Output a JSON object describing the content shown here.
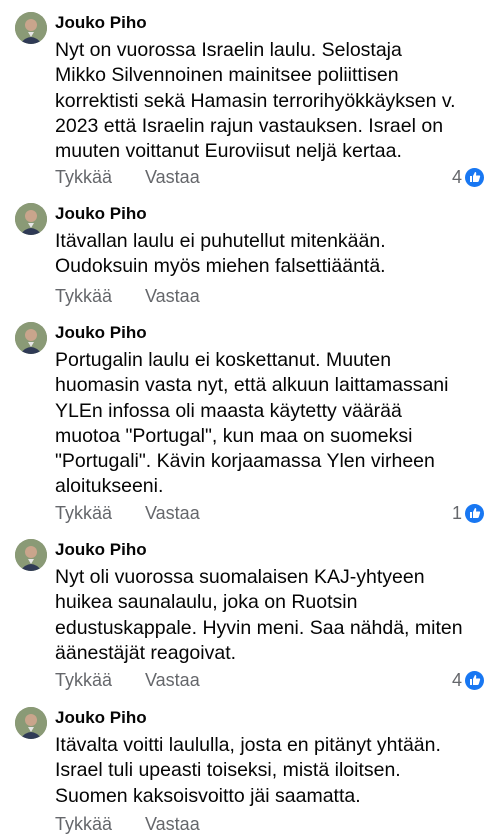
{
  "comments": [
    {
      "author": "Jouko Piho",
      "text": "Nyt on vuorossa Israelin laulu. Selostaja\nMikko Silvennoinen mainitsee poliittisen\nkorrektisti sekä Hamasin terrorihyökkäyksen v.\n2023 että Israelin rajun vastauksen. Israel on\nmuuten voittanut Euroviisut neljä kertaa.",
      "like_label": "Tykkää",
      "reply_label": "Vastaa",
      "reaction_count": "4",
      "reaction_icon": "thumbs-up-icon"
    },
    {
      "author": "Jouko Piho",
      "text": "Itävallan laulu ei puhutellut mitenkään.\nOudoksuin myös miehen falsettiääntä.",
      "like_label": "Tykkää",
      "reply_label": "Vastaa"
    },
    {
      "author": "Jouko Piho",
      "text": "Portugalin laulu ei koskettanut. Muuten\nhuomasin vasta nyt, että alkuun laittamassani\nYLEn infossa oli maasta käytetty väärää\nmuotoa \"Portugal\", kun maa on suomeksi\n\"Portugali\". Kävin korjaamassa Ylen virheen\naloitukseeni.",
      "like_label": "Tykkää",
      "reply_label": "Vastaa",
      "reaction_count": "1",
      "reaction_icon": "thumbs-up-icon"
    },
    {
      "author": "Jouko Piho",
      "text": "Nyt oli vuorossa suomalaisen KAJ-yhtyeen\nhuikea saunalaulu, joka on Ruotsin\nedustuskappale. Hyvin meni. Saa nähdä, miten\näänestäjät reagoivat.",
      "like_label": "Tykkää",
      "reply_label": "Vastaa",
      "reaction_count": "4",
      "reaction_icon": "thumbs-up-icon"
    },
    {
      "author": "Jouko Piho",
      "text": "Itävalta voitti laululla, josta en pitänyt yhtään.\nIsrael tuli upeasti toiseksi, mistä iloitsen.\nSuomen kaksoisvoitto jäi saamatta.",
      "like_label": "Tykkää",
      "reply_label": "Vastaa"
    }
  ],
  "colors": {
    "link_blue": "#1877f2",
    "meta_gray": "#65676b",
    "text": "#050505"
  }
}
